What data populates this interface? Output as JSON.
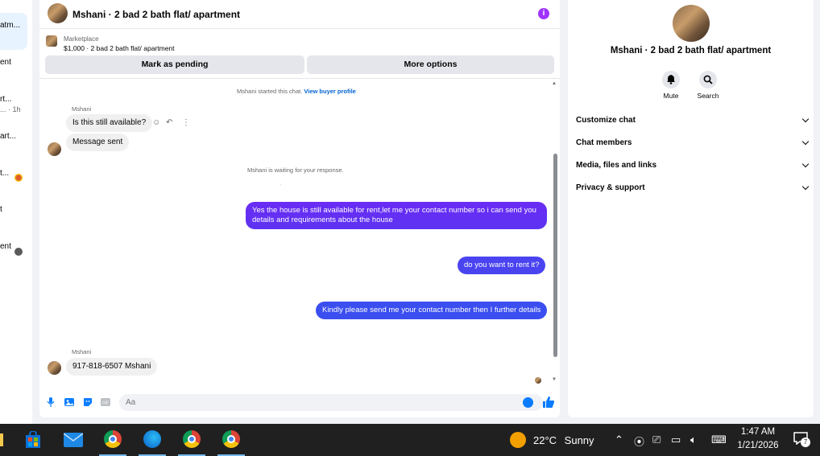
{
  "sidebar": {
    "items": [
      {
        "label": "atm...",
        "sub": ""
      },
      {
        "label": "ent",
        "sub": ""
      },
      {
        "label": "rt...",
        "sub": "... · 1h"
      },
      {
        "label": "art...",
        "sub": ""
      },
      {
        "label": "t...",
        "sub": ""
      },
      {
        "label": "t",
        "sub": ""
      },
      {
        "label": "ent",
        "sub": ""
      }
    ]
  },
  "chat": {
    "title": "Mshani · 2 bad 2 bath flat/ apartment",
    "info_icon": "i",
    "listing": {
      "category": "Marketplace",
      "price_title": "$1,000 · 2 bad 2 bath flat/ apartment"
    },
    "actions": {
      "pending": "Mark as pending",
      "more": "More options"
    },
    "system": {
      "started": "Mshani started this chat.",
      "buyer_link": "View buyer profile",
      "waiting": "Mshani is waiting for your response."
    },
    "messages": {
      "sender1": "Mshani",
      "in1": "Is this still available?",
      "in2": "Message sent",
      "out1": "Yes the house is still available for rent,let me your contact number so i can send you details and requirements about the house",
      "out2": "do you want to rent it?",
      "out3": "Kindly please send me your contact number then I further details",
      "sender2": "Mshani",
      "in3": "917-818-6507 Mshani"
    },
    "composer": {
      "placeholder": "Aa"
    },
    "colors": {
      "out_bubble_top": "#6a2cf5",
      "out_bubble_bottom": "#3b4ef0",
      "accent": "#0a7cff"
    }
  },
  "right_panel": {
    "title": "Mshani · 2 bad 2 bath flat/ apartment",
    "mute_label": "Mute",
    "search_label": "Search",
    "sections": [
      "Customize chat",
      "Chat members",
      "Media, files and links",
      "Privacy & support"
    ]
  },
  "taskbar": {
    "temperature": "22°C",
    "weather": "Sunny",
    "time": "1:47 AM",
    "date": "1/21/2026",
    "notifications": "7"
  }
}
